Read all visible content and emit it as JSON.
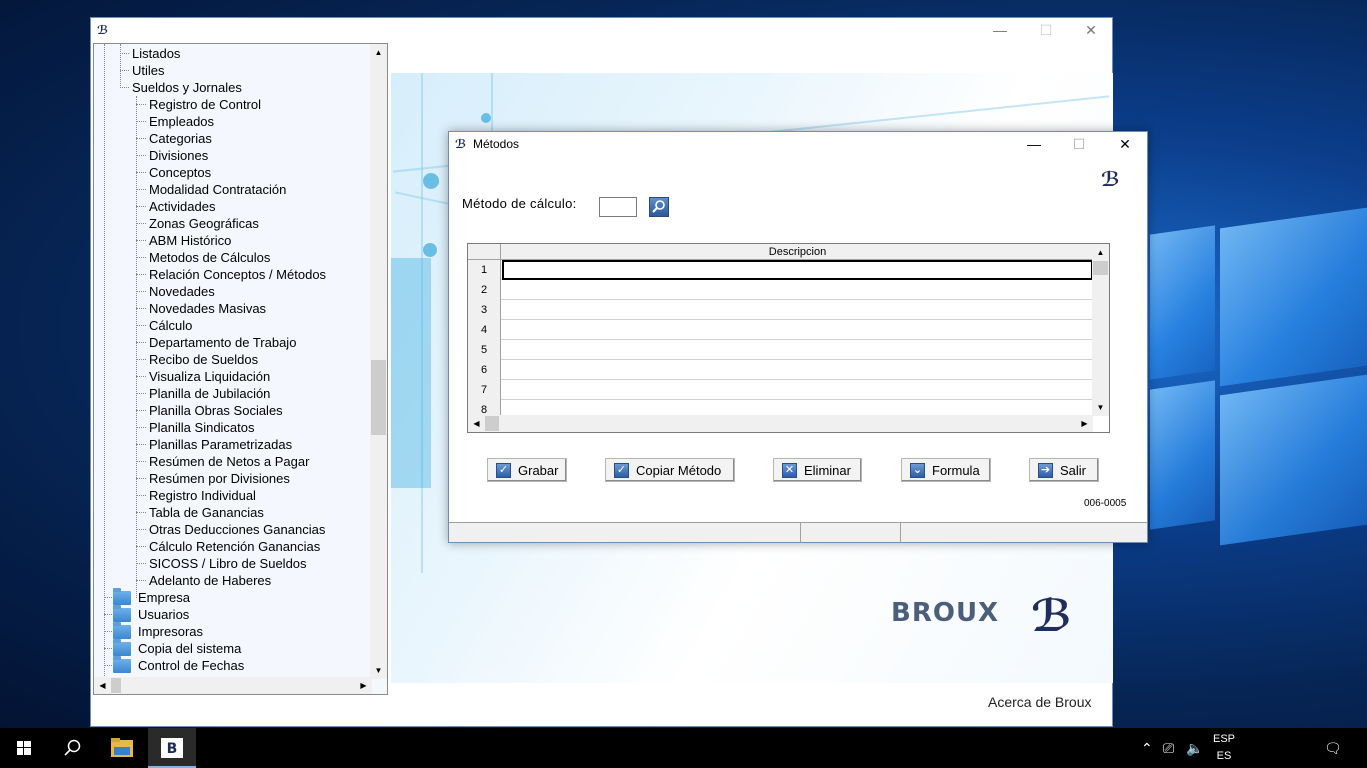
{
  "main_window": {
    "about_link": "Acerca de Broux",
    "logo_text": "BROUX",
    "controls": {
      "minimize": "—",
      "maximize": "☐",
      "close": "✕"
    }
  },
  "tree": {
    "items": [
      {
        "label": "Listados",
        "level": 1,
        "type": "leaf"
      },
      {
        "label": "Utiles",
        "level": 1,
        "type": "leaf"
      },
      {
        "label": "Sueldos y Jornales",
        "level": 1,
        "type": "leaf"
      },
      {
        "label": "Registro de Control",
        "level": 2,
        "type": "leaf"
      },
      {
        "label": "Empleados",
        "level": 2,
        "type": "leaf"
      },
      {
        "label": "Categorias",
        "level": 2,
        "type": "leaf"
      },
      {
        "label": "Divisiones",
        "level": 2,
        "type": "leaf"
      },
      {
        "label": "Conceptos",
        "level": 2,
        "type": "leaf"
      },
      {
        "label": "Modalidad Contratación",
        "level": 2,
        "type": "leaf"
      },
      {
        "label": "Actividades",
        "level": 2,
        "type": "leaf"
      },
      {
        "label": "Zonas Geográficas",
        "level": 2,
        "type": "leaf"
      },
      {
        "label": "ABM Histórico",
        "level": 2,
        "type": "leaf"
      },
      {
        "label": "Metodos de Cálculos",
        "level": 2,
        "type": "leaf"
      },
      {
        "label": "Relación Conceptos / Métodos",
        "level": 2,
        "type": "leaf"
      },
      {
        "label": "Novedades",
        "level": 2,
        "type": "leaf"
      },
      {
        "label": "Novedades Masivas",
        "level": 2,
        "type": "leaf"
      },
      {
        "label": "Cálculo",
        "level": 2,
        "type": "leaf"
      },
      {
        "label": "Departamento de Trabajo",
        "level": 2,
        "type": "leaf"
      },
      {
        "label": "Recibo de Sueldos",
        "level": 2,
        "type": "leaf"
      },
      {
        "label": "Visualiza Liquidación",
        "level": 2,
        "type": "leaf"
      },
      {
        "label": "Planilla de Jubilación",
        "level": 2,
        "type": "leaf"
      },
      {
        "label": "Planilla Obras Sociales",
        "level": 2,
        "type": "leaf"
      },
      {
        "label": "Planilla Sindicatos",
        "level": 2,
        "type": "leaf"
      },
      {
        "label": "Planillas Parametrizadas",
        "level": 2,
        "type": "leaf"
      },
      {
        "label": "Resúmen de Netos a Pagar",
        "level": 2,
        "type": "leaf"
      },
      {
        "label": "Resúmen por Divisiones",
        "level": 2,
        "type": "leaf"
      },
      {
        "label": "Registro Individual",
        "level": 2,
        "type": "leaf"
      },
      {
        "label": "Tabla de Ganancias",
        "level": 2,
        "type": "leaf"
      },
      {
        "label": "Otras Deducciones Ganancias",
        "level": 2,
        "type": "leaf"
      },
      {
        "label": "Cálculo Retención Ganancias",
        "level": 2,
        "type": "leaf"
      },
      {
        "label": "SICOSS / Libro de Sueldos",
        "level": 2,
        "type": "leaf"
      },
      {
        "label": "Adelanto de Haberes",
        "level": 2,
        "type": "leaf"
      },
      {
        "label": "Empresa",
        "level": 0,
        "type": "folder"
      },
      {
        "label": "Usuarios",
        "level": 0,
        "type": "folder"
      },
      {
        "label": "Impresoras",
        "level": 0,
        "type": "folder"
      },
      {
        "label": "Copia del sistema",
        "level": 0,
        "type": "folder"
      },
      {
        "label": "Control de Fechas",
        "level": 0,
        "type": "folder"
      }
    ]
  },
  "dialog": {
    "title": "Métodos",
    "calc_label": "Método de cálculo:",
    "calc_value": "",
    "grid": {
      "column": "Descripcion",
      "rows": [
        "1",
        "2",
        "3",
        "4",
        "5",
        "6",
        "7",
        "8"
      ]
    },
    "buttons": {
      "grabar": "Grabar",
      "copiar": "Copiar Método",
      "eliminar": "Eliminar",
      "formula": "Formula",
      "salir": "Salir"
    },
    "form_code": "006-0005"
  },
  "taskbar": {
    "lang_top": "ESP",
    "lang_bottom": "ES"
  }
}
